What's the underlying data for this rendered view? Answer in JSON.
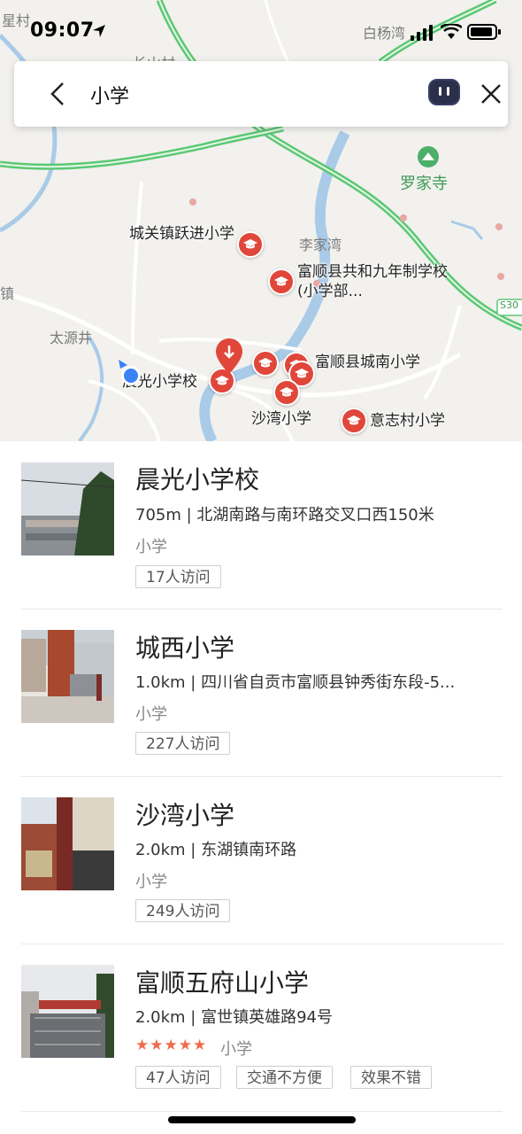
{
  "status": {
    "time": "09:07"
  },
  "search": {
    "query": "小学"
  },
  "map": {
    "labels": {
      "xingcun": "星村",
      "baiyangwan": "白杨湾",
      "changshancun": "长山村",
      "zhen": "镇",
      "taiyuanjing": "太源井",
      "lijiawan": "李家湾",
      "luojiasi": "罗家寺",
      "road": "S30"
    },
    "pois": {
      "yuejin": "城关镇跃进小学",
      "gonghe": "富顺县共和九年制学校(小学部...",
      "chenguang": "晨光小学校",
      "chengnan": "富顺县城南小学",
      "shawan": "沙湾小学",
      "yizhicun": "意志村小学"
    }
  },
  "results": [
    {
      "title": "晨光小学校",
      "meta": "705m | 北湖南路与南环路交叉口西150米",
      "category": "小学",
      "tags": [
        "17人访问"
      ]
    },
    {
      "title": "城西小学",
      "meta": "1.0km | 四川省自贡市富顺县钟秀街东段-5...",
      "category": "小学",
      "tags": [
        "227人访问"
      ]
    },
    {
      "title": "沙湾小学",
      "meta": "2.0km | 东湖镇南环路",
      "category": "小学",
      "tags": [
        "249人访问"
      ]
    },
    {
      "title": "富顺五府山小学",
      "meta": "2.0km | 富世镇英雄路94号",
      "category": "小学",
      "rating": 5,
      "stars": "★★★★★",
      "tags": [
        "47人访问",
        "交通不方便",
        "效果不错"
      ]
    }
  ],
  "colors": {
    "pin": "#e0473a",
    "road": "#5cc873",
    "water": "#a9cbe8",
    "location": "#3b82f6"
  }
}
